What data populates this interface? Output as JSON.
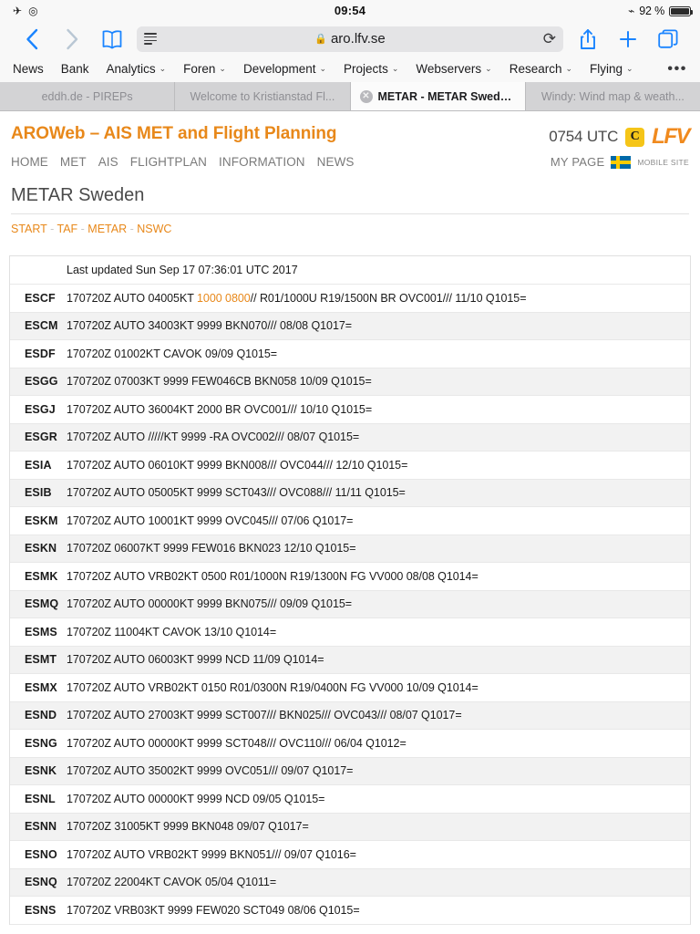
{
  "statusbar": {
    "airplane_icon": "airplane-mode-icon",
    "rotation_icon": "rotation-lock-icon",
    "time": "09:54",
    "bluetooth_icon": "bluetooth-icon",
    "battery_percent": "92 %",
    "battery_level": 92
  },
  "browser": {
    "back_label": "‹",
    "forward_label": "›",
    "bookmarks_label": "bookmarks",
    "reader_label": "reader-view",
    "url": "aro.lfv.se",
    "lock_label": "🔒",
    "reload_label": "⟳",
    "share_label": "share",
    "newtab_label": "+",
    "tabs_label": "tabs",
    "favorites": [
      {
        "label": "News",
        "has_menu": false
      },
      {
        "label": "Bank",
        "has_menu": false
      },
      {
        "label": "Analytics",
        "has_menu": true
      },
      {
        "label": "Foren",
        "has_menu": true
      },
      {
        "label": "Development",
        "has_menu": true
      },
      {
        "label": "Projects",
        "has_menu": true
      },
      {
        "label": "Webservers",
        "has_menu": true
      },
      {
        "label": "Research",
        "has_menu": true
      },
      {
        "label": "Flying",
        "has_menu": true
      }
    ],
    "favorites_more": "•••",
    "tabs": [
      {
        "label": "eddh.de - PIREPs",
        "active": false
      },
      {
        "label": "Welcome to Kristianstad Fl...",
        "active": false
      },
      {
        "label": "METAR - METAR Swede...",
        "active": true
      },
      {
        "label": "Windy: Wind map & weath...",
        "active": false
      }
    ]
  },
  "site": {
    "title": "AROWeb – AIS MET and Flight Planning",
    "utc_time": "0754 UTC",
    "c_badge": "C",
    "logo": "LFV",
    "nav": [
      "HOME",
      "MET",
      "AIS",
      "FLIGHTPLAN",
      "INFORMATION",
      "NEWS"
    ],
    "my_page": "MY PAGE",
    "flag": "swedish-flag",
    "mobile_site": "MOBILE SITE"
  },
  "content": {
    "heading": "METAR Sweden",
    "breadcrumbs": [
      "START",
      "TAF",
      "METAR",
      "NSWC"
    ],
    "breadcrumb_separator": "-",
    "last_updated": "Last updated Sun Sep 17 07:36:01 UTC 2017",
    "highlight_color": "#e8881a",
    "rows": [
      {
        "icao": "ESCF",
        "pre": "170720Z AUTO 04005KT ",
        "highlight": "1000 0800",
        "post": "// R01/1000U R19/1500N BR OVC001/// 11/10 Q1015="
      },
      {
        "icao": "ESCM",
        "pre": "170720Z AUTO 34003KT 9999 BKN070/// 08/08 Q1017=",
        "highlight": "",
        "post": ""
      },
      {
        "icao": "ESDF",
        "pre": "170720Z 01002KT CAVOK 09/09 Q1015=",
        "highlight": "",
        "post": ""
      },
      {
        "icao": "ESGG",
        "pre": "170720Z 07003KT 9999 FEW046CB BKN058 10/09 Q1015=",
        "highlight": "",
        "post": ""
      },
      {
        "icao": "ESGJ",
        "pre": "170720Z AUTO 36004KT 2000 BR OVC001/// 10/10 Q1015=",
        "highlight": "",
        "post": ""
      },
      {
        "icao": "ESGR",
        "pre": "170720Z AUTO /////KT 9999 -RA OVC002/// 08/07 Q1015=",
        "highlight": "",
        "post": ""
      },
      {
        "icao": "ESIA",
        "pre": "170720Z AUTO 06010KT 9999 BKN008/// OVC044/// 12/10 Q1015=",
        "highlight": "",
        "post": ""
      },
      {
        "icao": "ESIB",
        "pre": "170720Z AUTO 05005KT 9999 SCT043/// OVC088/// 11/11 Q1015=",
        "highlight": "",
        "post": ""
      },
      {
        "icao": "ESKM",
        "pre": "170720Z AUTO 10001KT 9999 OVC045/// 07/06 Q1017=",
        "highlight": "",
        "post": ""
      },
      {
        "icao": "ESKN",
        "pre": "170720Z 06007KT 9999 FEW016 BKN023 12/10 Q1015=",
        "highlight": "",
        "post": ""
      },
      {
        "icao": "ESMK",
        "pre": "170720Z AUTO VRB02KT 0500 R01/1000N R19/1300N FG VV000 08/08 Q1014=",
        "highlight": "",
        "post": ""
      },
      {
        "icao": "ESMQ",
        "pre": "170720Z AUTO 00000KT 9999 BKN075/// 09/09 Q1015=",
        "highlight": "",
        "post": ""
      },
      {
        "icao": "ESMS",
        "pre": "170720Z 11004KT CAVOK 13/10 Q1014=",
        "highlight": "",
        "post": ""
      },
      {
        "icao": "ESMT",
        "pre": "170720Z AUTO 06003KT 9999 NCD 11/09 Q1014=",
        "highlight": "",
        "post": ""
      },
      {
        "icao": "ESMX",
        "pre": "170720Z AUTO VRB02KT 0150 R01/0300N R19/0400N FG VV000 10/09 Q1014=",
        "highlight": "",
        "post": ""
      },
      {
        "icao": "ESND",
        "pre": "170720Z AUTO 27003KT 9999 SCT007/// BKN025/// OVC043/// 08/07 Q1017=",
        "highlight": "",
        "post": ""
      },
      {
        "icao": "ESNG",
        "pre": "170720Z AUTO 00000KT 9999 SCT048/// OVC110/// 06/04 Q1012=",
        "highlight": "",
        "post": ""
      },
      {
        "icao": "ESNK",
        "pre": "170720Z AUTO 35002KT 9999 OVC051/// 09/07 Q1017=",
        "highlight": "",
        "post": ""
      },
      {
        "icao": "ESNL",
        "pre": "170720Z AUTO 00000KT 9999 NCD 09/05 Q1015=",
        "highlight": "",
        "post": ""
      },
      {
        "icao": "ESNN",
        "pre": "170720Z 31005KT 9999 BKN048 09/07 Q1017=",
        "highlight": "",
        "post": ""
      },
      {
        "icao": "ESNO",
        "pre": "170720Z AUTO VRB02KT 9999 BKN051/// 09/07 Q1016=",
        "highlight": "",
        "post": ""
      },
      {
        "icao": "ESNQ",
        "pre": "170720Z 22004KT CAVOK 05/04 Q1011=",
        "highlight": "",
        "post": ""
      },
      {
        "icao": "ESNS",
        "pre": "170720Z VRB03KT 9999 FEW020 SCT049 08/06 Q1015=",
        "highlight": "",
        "post": ""
      }
    ]
  }
}
